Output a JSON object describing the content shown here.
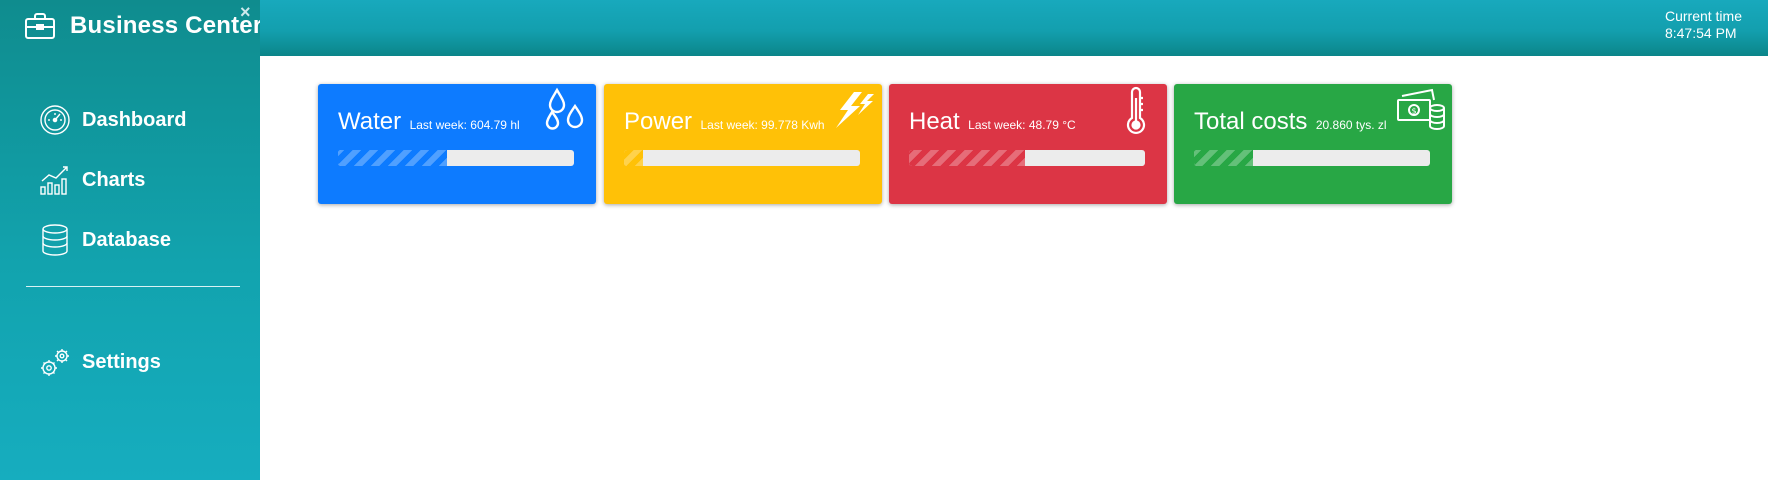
{
  "app": {
    "title": "Business Center",
    "close_label": "×"
  },
  "sidebar": {
    "items": [
      {
        "label": "Dashboard",
        "icon": "dashboard-gauge-icon"
      },
      {
        "label": "Charts",
        "icon": "bar-chart-icon"
      },
      {
        "label": "Database",
        "icon": "database-icon"
      }
    ],
    "settings": {
      "label": "Settings",
      "icon": "gears-icon"
    }
  },
  "header": {
    "time_label": "Current time",
    "time_value": "8:47:54 PM"
  },
  "cards": [
    {
      "title": "Water",
      "subtitle": "Last week: 604.79 hl",
      "color": "#0d7bff",
      "icon": "water-drops-icon",
      "progress": 0.46
    },
    {
      "title": "Power",
      "subtitle": "Last week: 99.778 Kwh",
      "color": "#ffc107",
      "icon": "lightning-icon",
      "progress": 0.08
    },
    {
      "title": "Heat",
      "subtitle": "Last week: 48.79 °C",
      "color": "#dc3545",
      "icon": "thermometer-icon",
      "progress": 0.49
    },
    {
      "title": "Total costs",
      "subtitle": "20.860 tys. zl",
      "color": "#28a745",
      "icon": "money-coins-icon",
      "progress": 0.25
    }
  ],
  "colors": {
    "sidebar": "#12a3ae",
    "topbar": "#139fae",
    "bar_track": "#ececec"
  }
}
